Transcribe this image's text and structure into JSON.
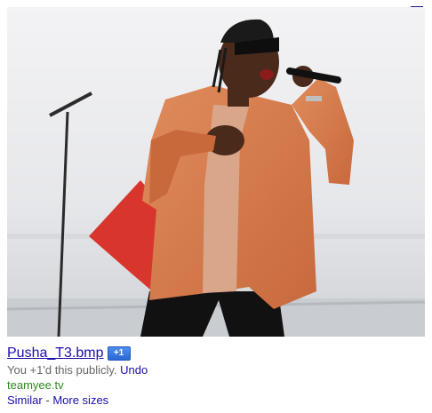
{
  "close": {
    "icon": "close-x-icon"
  },
  "image": {
    "description_icon": "photo-performer-icon"
  },
  "result": {
    "title": "Pusha_T3.bmp",
    "plus_badge": "+1",
    "plus_status_text": "You +1'd this publicly.",
    "undo_label": "Undo",
    "site": "teamyee.tv",
    "similar_label": "Similar",
    "separator": "-",
    "more_sizes_label": "More sizes"
  },
  "colors": {
    "link": "#1a0dab",
    "site_green": "#2c8a1d",
    "badge_blue": "#2a66d6"
  }
}
